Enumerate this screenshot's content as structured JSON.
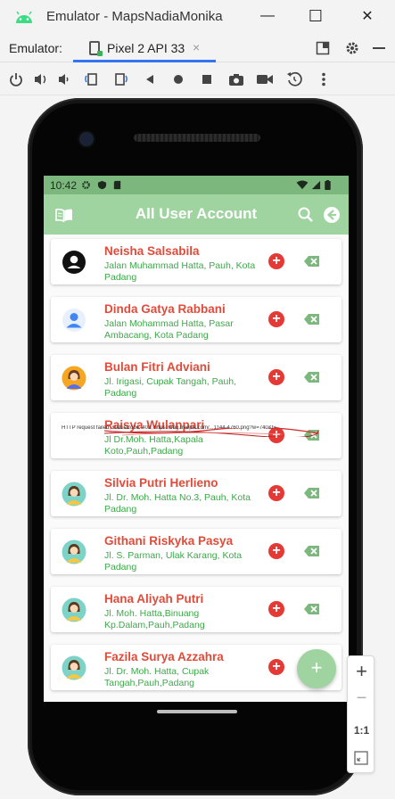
{
  "window": {
    "title": "Emulator - MapsNadiaMonika",
    "minimize": "—",
    "maximize": "☐",
    "close": "✕"
  },
  "tabbar": {
    "label": "Emulator:",
    "device_tab": "Pixel 2 API 33",
    "tab_close": "×"
  },
  "toolbar": {
    "icons": [
      "power-icon",
      "volume-up-icon",
      "volume-down-icon",
      "rotate-left-icon",
      "rotate-right-icon",
      "back-icon",
      "home-icon",
      "overview-icon",
      "screenshot-icon",
      "record-icon",
      "replay-icon",
      "more-icon"
    ]
  },
  "status": {
    "time": "10:42"
  },
  "app": {
    "title": "All User Account",
    "accent": "#9fd4a1",
    "statusbar_color": "#7cb87e"
  },
  "users": [
    {
      "name": "Neisha Salsabila",
      "address": "Jalan Muhammad Hatta, Pauh, Kota Padang",
      "avatar": "default-person-icon"
    },
    {
      "name": "Dinda Gatya Rabbani",
      "address": "Jalan Mohammad Hatta, Pasar Ambacang, Kota Padang",
      "avatar": "blue-person-icon"
    },
    {
      "name": "Bulan Fitri Adviani",
      "address": "Jl. Irigasi, Cupak Tangah, Pauh, Padang",
      "avatar": "woman-orange-avatar"
    },
    {
      "name": "Raisya Wulanpari",
      "address": "Jl Dr.Moh. Hatta,Kapala Koto,Pauh,Padang",
      "avatar": "broken-image"
    },
    {
      "name": "Silvia Putri Herlieno",
      "address": "Jl. Dr. Moh. Hatta No.3, Pauh, Kota Padang",
      "avatar": "woman-teal-avatar"
    },
    {
      "name": "Githani Riskyka Pasya",
      "address": "Jl. S. Parman, Ulak Karang, Kota Padang",
      "avatar": "woman-teal-avatar"
    },
    {
      "name": "Hana Aliyah Putri",
      "address": "Jl. Moh. Hatta,Binuang Kp.Dalam,Pauh,Padang",
      "avatar": "woman-teal-avatar"
    },
    {
      "name": "Fazila Surya Azzahra",
      "address": "Jl. Dr. Moh. Hatta, Cupak Tangah,Pauh,Padang",
      "avatar": "woman-teal-avatar"
    }
  ],
  "error_text": "HTTP request failed, statusCode: 403, https://img.freepik.com/...1144-4760.png?w=740&t=",
  "fab_label": "+",
  "zoom": {
    "plus": "+",
    "minus": "−",
    "ratio": "1:1"
  }
}
